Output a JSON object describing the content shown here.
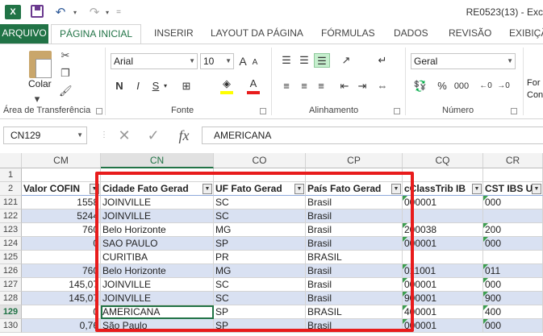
{
  "window": {
    "title": "RE0523(13) - Exc",
    "excel_logo": "X",
    "undo_icon": "↶",
    "redo_icon": "↷",
    "dropdown_icon": "▾",
    "qa_customize": "="
  },
  "tabs": [
    {
      "label": "ARQUIVO"
    },
    {
      "label": "PÁGINA INICIAL"
    },
    {
      "label": "INSERIR"
    },
    {
      "label": "LAYOUT DA PÁGINA"
    },
    {
      "label": "FÓRMULAS"
    },
    {
      "label": "DADOS"
    },
    {
      "label": "REVISÃO"
    },
    {
      "label": "EXIBIÇÃ"
    }
  ],
  "ribbon": {
    "clipboard": {
      "paste_label": "Colar",
      "group_label": "Área de Transferência"
    },
    "font": {
      "name": "Arial",
      "size": "10",
      "bold": "N",
      "italic": "I",
      "underline": "S",
      "group_label": "Fonte",
      "fill_color": "#ffff00",
      "font_color": "#e81c1c",
      "grow": "A",
      "shrink": "A",
      "font_letter": "A"
    },
    "alignment": {
      "group_label": "Alinhamento"
    },
    "number": {
      "format": "Geral",
      "percent": "%",
      "thousands": "000",
      "group_label": "Número"
    },
    "styles_partial": {
      "line1": "For",
      "line2": "Con"
    }
  },
  "formula_bar": {
    "name_box": "CN129",
    "cancel": "✕",
    "enter": "✓",
    "fx": "fx",
    "formula": "AMERICANA"
  },
  "columns": [
    "CM",
    "CN",
    "CO",
    "CP",
    "CQ",
    "CR"
  ],
  "row_numbers": [
    "1",
    "2",
    "121",
    "122",
    "123",
    "124",
    "125",
    "126",
    "127",
    "128",
    "129",
    "130"
  ],
  "headers": [
    "Valor COFIN",
    "Cidade Fato Gerad",
    "UF Fato Gerad",
    "País Fato Gerad",
    "cClassTrib IB",
    "CST IBS UF"
  ],
  "rows": [
    [
      "1558",
      "JOINVILLE",
      "SC",
      "Brasil",
      "000001",
      "000"
    ],
    [
      "5244",
      "JOINVILLE",
      "SC",
      "Brasil",
      "",
      ""
    ],
    [
      "760",
      "Belo Horizonte",
      "MG",
      "Brasil",
      "200038",
      "200"
    ],
    [
      "0",
      "SAO PAULO",
      "SP",
      "Brasil",
      "000001",
      "000"
    ],
    [
      "",
      "CURITIBA",
      "PR",
      "BRASIL",
      "",
      ""
    ],
    [
      "760",
      "Belo Horizonte",
      "MG",
      "Brasil",
      "011001",
      "011"
    ],
    [
      "145,07",
      "JOINVILLE",
      "SC",
      "Brasil",
      "000001",
      "000"
    ],
    [
      "145,07",
      "JOINVILLE",
      "SC",
      "Brasil",
      "900001",
      "900"
    ],
    [
      "0",
      "AMERICANA",
      "SP",
      "BRASIL",
      "400001",
      "400"
    ],
    [
      "0,76",
      "São Paulo",
      "SP",
      "Brasil",
      "000001",
      "000"
    ]
  ],
  "colors": {
    "accent": "#217346",
    "band": "#d9e1f2",
    "highlight_box": "#e81c1c"
  }
}
